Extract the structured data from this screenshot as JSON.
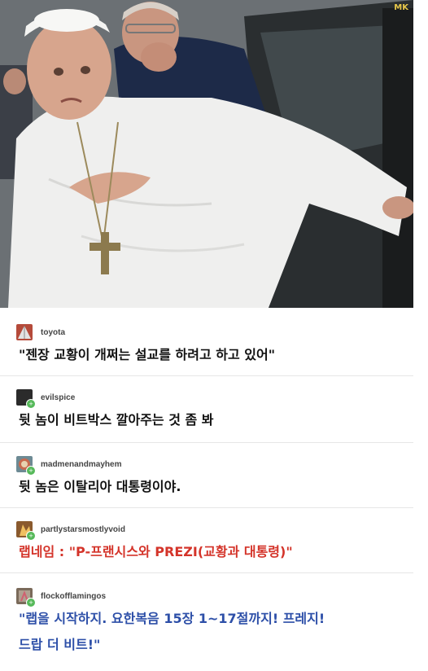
{
  "photo": {
    "watermark": "MK",
    "colors": {
      "sky": "#6b7074",
      "car": "#2a2e30",
      "robe": "#efefee",
      "suit": "#1d2a48",
      "skin": "#d7a58d"
    }
  },
  "posts": [
    {
      "user": "toyota",
      "avatar_icon": "pyramid-icon",
      "avatar_color": "#b54a3a",
      "text": "\"젠장 교황이 개쩌는 설교를 하려고 하고 있어\"",
      "color": "#111111"
    },
    {
      "user": "evilspice",
      "avatar_icon": "dark-avatar-icon",
      "avatar_color": "#2b2b2b",
      "text": "뒷 놈이 비트박스 깔아주는 것 좀 봐",
      "color": "#111111"
    },
    {
      "user": "madmenandmayhem",
      "avatar_icon": "round-avatar-icon",
      "avatar_color": "#6d8a94",
      "text": "뒷 놈은 이탈리아 대통령이야.",
      "color": "#111111"
    },
    {
      "user": "partlystarsmostlyvoid",
      "avatar_icon": "figure-avatar-icon",
      "avatar_color": "#8a5a2e",
      "text": "랩네임 : \"P-프랜시스와 PREZI(교황과 대통령)\"",
      "color": "#d4342a"
    },
    {
      "user": "flockofflamingos",
      "avatar_icon": "flamingo-avatar-icon",
      "avatar_color": "#7a6a5a",
      "text_line1": "\"랩을 시작하지. 요한복음 15장 1~17절까지! 프레지!",
      "text_line2": "드랍 더 비트!\"",
      "color": "#2d4fa8"
    }
  ]
}
